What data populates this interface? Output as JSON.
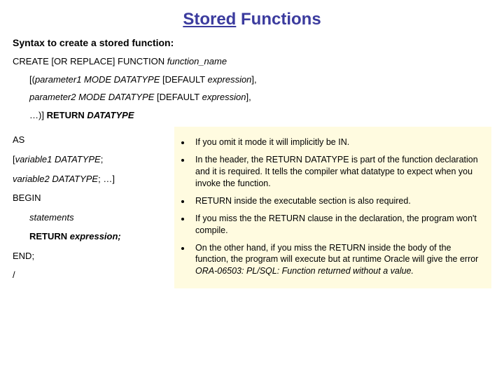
{
  "title": {
    "part1": "Stored",
    "part2": " Functions"
  },
  "subtitle": "Syntax to create a stored function:",
  "syntax": {
    "line1_a": "CREATE [OR REPLACE] FUNCTION ",
    "line1_b": "function_name",
    "line2_a": "[(",
    "line2_b": "parameter1 MODE DATATYPE ",
    "line2_c": "[DEFAULT ",
    "line2_d": "expression",
    "line2_e": "],",
    "line3_a": "parameter2 MODE DATATYPE ",
    "line3_b": "[DEFAULT ",
    "line3_c": "expression",
    "line3_d": "],",
    "line4_a": "…)] ",
    "line4_b": "RETURN ",
    "line4_c": "DATATYPE"
  },
  "left": {
    "as": "AS",
    "var1_a": "[",
    "var1_b": "variable1 DATATYPE",
    "var1_c": ";",
    "var2_a": "variable2 DATATYPE",
    "var2_b": "; …]",
    "begin": "BEGIN",
    "stmts": "statements",
    "ret_a": "RETURN ",
    "ret_b": "expression;",
    "end": "END;",
    "slash": "/"
  },
  "bullets": [
    "If you omit it mode it will implicitly be IN.",
    "In the header, the RETURN DATATYPE is part of the function declaration and it is required. It tells the compiler what datatype to expect when you invoke the function.",
    "RETURN inside the executable section is also required.",
    "If you miss the the RETURN clause in the declaration, the program won't compile.",
    "On the other hand, if you miss the RETURN inside the body of the function, the program will execute but at runtime Oracle will give the error ORA-06503: PL/SQL: Function returned without a value."
  ]
}
